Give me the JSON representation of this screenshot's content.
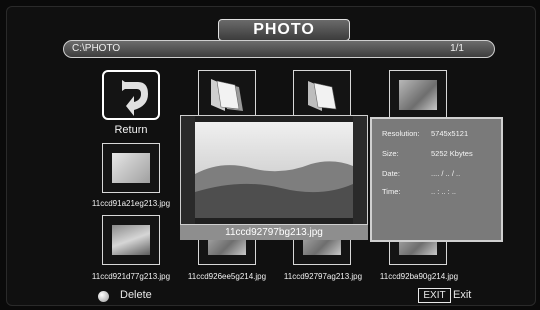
{
  "header": {
    "title": "PHOTO"
  },
  "pathbar": {
    "path": "C:\\PHOTO",
    "page": "1/1"
  },
  "grid": {
    "return_label": "Return",
    "file1": "11ccd91a21eg213.jpg",
    "row3": [
      "11ccd921d77g213.jpg",
      "11ccd926ee5g214.jpg",
      "11ccd92797ag213.jpg",
      "11ccd92ba90g214.jpg"
    ]
  },
  "preview": {
    "filename": "11ccd92797bg213.jpg"
  },
  "info": {
    "resolution_label": "Resolution:",
    "resolution_value": "5745x5121",
    "size_label": "Size:",
    "size_value": "5252 Kbytes",
    "date_label": "Date:",
    "date_value": ".... / .. / ..",
    "time_label": "Time:",
    "time_value": ".. : .. : .."
  },
  "footer": {
    "delete_label": "Delete",
    "exit_key": "EXIT",
    "exit_label": "Exit"
  },
  "icons": [
    "return-arrow-icon",
    "folder-icon",
    "image-thumbnail-icon",
    "delete-dot-icon"
  ]
}
